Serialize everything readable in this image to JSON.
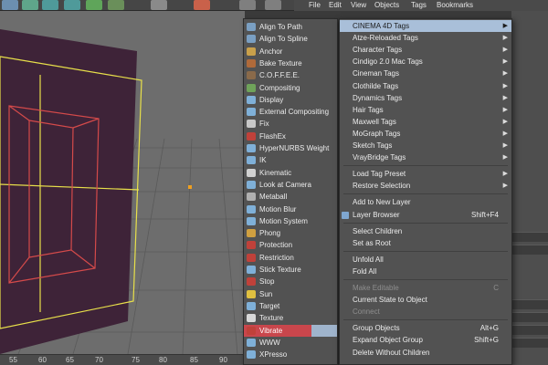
{
  "menubar": {
    "items": [
      "File",
      "Edit",
      "View",
      "Objects",
      "Tags",
      "Bookmarks"
    ]
  },
  "ruler": {
    "labels": [
      "55",
      "60",
      "65",
      "70",
      "75",
      "80",
      "85",
      "90"
    ]
  },
  "submenu": {
    "items": [
      {
        "label": "Align To Path",
        "icon": "align-path-icon",
        "color": "#7a9fc2"
      },
      {
        "label": "Align To Spline",
        "icon": "align-spline-icon",
        "color": "#7a9fc2"
      },
      {
        "label": "Anchor",
        "icon": "anchor-icon",
        "color": "#c9a04a"
      },
      {
        "label": "Bake Texture",
        "icon": "bake-texture-icon",
        "color": "#b06a3a"
      },
      {
        "label": "C.O.F.F.E.E.",
        "icon": "coffee-icon",
        "color": "#8a6a4a"
      },
      {
        "label": "Compositing",
        "icon": "compositing-icon",
        "color": "#6fa35a"
      },
      {
        "label": "Display",
        "icon": "display-icon",
        "color": "#7fb0d8"
      },
      {
        "label": "External Compositing",
        "icon": "external-compositing-icon",
        "color": "#7fb0d8"
      },
      {
        "label": "Fix",
        "icon": "fix-icon",
        "color": "#c7c7c7"
      },
      {
        "label": "FlashEx",
        "icon": "flashex-icon",
        "color": "#c0413a"
      },
      {
        "label": "HyperNURBS Weight",
        "icon": "hypernurbs-icon",
        "color": "#7fb0d8"
      },
      {
        "label": "IK",
        "icon": "ik-icon",
        "color": "#7fb0d8"
      },
      {
        "label": "Kinematic",
        "icon": "kinematic-icon",
        "color": "#d0d0d0"
      },
      {
        "label": "Look at Camera",
        "icon": "look-camera-icon",
        "color": "#7fb0d8"
      },
      {
        "label": "Metaball",
        "icon": "metaball-icon",
        "color": "#b0b0b0"
      },
      {
        "label": "Motion Blur",
        "icon": "motion-blur-icon",
        "color": "#7fb0d8"
      },
      {
        "label": "Motion System",
        "icon": "motion-system-icon",
        "color": "#7fb0d8"
      },
      {
        "label": "Phong",
        "icon": "phong-icon",
        "color": "#d0a040"
      },
      {
        "label": "Protection",
        "icon": "protection-icon",
        "color": "#c0413a"
      },
      {
        "label": "Restriction",
        "icon": "restriction-icon",
        "color": "#c0413a"
      },
      {
        "label": "Stick Texture",
        "icon": "stick-texture-icon",
        "color": "#7fb0d8"
      },
      {
        "label": "Stop",
        "icon": "stop-icon",
        "color": "#c0413a"
      },
      {
        "label": "Sun",
        "icon": "sun-icon",
        "color": "#e0c040"
      },
      {
        "label": "Target",
        "icon": "target-icon",
        "color": "#7fb0d8"
      },
      {
        "label": "Texture",
        "icon": "texture-icon",
        "color": "#d8d8d8"
      },
      {
        "label": "Vibrate",
        "icon": "vibrate-icon",
        "color": "#c0413a",
        "highlighted": true
      },
      {
        "label": "WWW",
        "icon": "www-icon",
        "color": "#7fb0d8"
      },
      {
        "label": "XPresso",
        "icon": "xpresso-icon",
        "color": "#7fb0d8"
      }
    ]
  },
  "ctxmenu": {
    "items": [
      {
        "label": "CINEMA 4D Tags",
        "arrow": true,
        "highlighted": true
      },
      {
        "label": "Atze-Reloaded Tags",
        "arrow": true
      },
      {
        "label": "Character Tags",
        "arrow": true
      },
      {
        "label": "Cindigo 2.0 Mac Tags",
        "arrow": true
      },
      {
        "label": "Cineman Tags",
        "arrow": true
      },
      {
        "label": "Clothilde Tags",
        "arrow": true
      },
      {
        "label": "Dynamics Tags",
        "arrow": true
      },
      {
        "label": "Hair Tags",
        "arrow": true
      },
      {
        "label": "Maxwell Tags",
        "arrow": true
      },
      {
        "label": "MoGraph Tags",
        "arrow": true
      },
      {
        "label": "Sketch Tags",
        "arrow": true
      },
      {
        "label": "VrayBridge Tags",
        "arrow": true
      },
      {
        "separator": true
      },
      {
        "label": "Load Tag Preset",
        "arrow": true
      },
      {
        "label": "Restore Selection",
        "arrow": true
      },
      {
        "separator": true
      },
      {
        "label": "Add to New Layer"
      },
      {
        "label": "Layer Browser",
        "shortcut": "Shift+F4",
        "icon": "layer-browser-icon"
      },
      {
        "separator": true
      },
      {
        "label": "Select Children"
      },
      {
        "label": "Set as Root"
      },
      {
        "separator": true
      },
      {
        "label": "Unfold All"
      },
      {
        "label": "Fold All"
      },
      {
        "separator": true
      },
      {
        "label": "Make Editable",
        "shortcut": "C",
        "disabled": true
      },
      {
        "label": "Current State to Object"
      },
      {
        "label": "Connect",
        "disabled": true
      },
      {
        "separator": true
      },
      {
        "label": "Group Objects",
        "shortcut": "Alt+G"
      },
      {
        "label": "Expand Object Group",
        "shortcut": "Shift+G"
      },
      {
        "label": "Delete Without Children"
      }
    ]
  }
}
